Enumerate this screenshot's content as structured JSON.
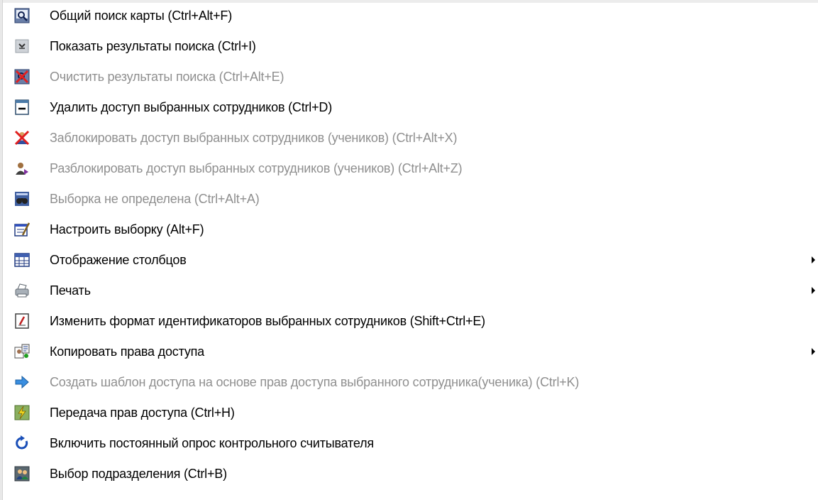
{
  "menu": {
    "items": [
      {
        "label": "Общий поиск карты (Ctrl+Alt+F)",
        "enabled": true,
        "submenu": false,
        "icon": "map-search-icon"
      },
      {
        "label": "Показать результаты поиска (Ctrl+I)",
        "enabled": true,
        "submenu": false,
        "icon": "show-results-icon"
      },
      {
        "label": "Очистить результаты поиска (Ctrl+Alt+E)",
        "enabled": false,
        "submenu": false,
        "icon": "clear-results-icon"
      },
      {
        "label": "Удалить доступ выбранных сотрудников (Ctrl+D)",
        "enabled": true,
        "submenu": false,
        "icon": "delete-access-icon"
      },
      {
        "label": "Заблокировать доступ выбранных сотрудников (учеников) (Ctrl+Alt+X)",
        "enabled": false,
        "submenu": false,
        "icon": "block-access-icon"
      },
      {
        "label": "Разблокировать доступ выбранных сотрудников (учеников) (Ctrl+Alt+Z)",
        "enabled": false,
        "submenu": false,
        "icon": "unblock-access-icon"
      },
      {
        "label": "Выборка не определена (Ctrl+Alt+A)",
        "enabled": false,
        "submenu": false,
        "icon": "binoculars-icon"
      },
      {
        "label": "Настроить выборку (Alt+F)",
        "enabled": true,
        "submenu": false,
        "icon": "configure-selection-icon"
      },
      {
        "label": "Отображение столбцов",
        "enabled": true,
        "submenu": true,
        "icon": "columns-icon"
      },
      {
        "label": "Печать",
        "enabled": true,
        "submenu": true,
        "icon": "printer-icon"
      },
      {
        "label": "Изменить формат идентификаторов выбранных сотрудников (Shift+Ctrl+E)",
        "enabled": true,
        "submenu": false,
        "icon": "id-format-icon"
      },
      {
        "label": "Копировать права доступа",
        "enabled": true,
        "submenu": true,
        "icon": "copy-rights-icon"
      },
      {
        "label": "Создать шаблон доступа на основе прав доступа выбранного сотрудника(ученика) (Ctrl+K)",
        "enabled": false,
        "submenu": false,
        "icon": "blue-arrow-icon"
      },
      {
        "label": "Передача прав доступа (Ctrl+H)",
        "enabled": true,
        "submenu": false,
        "icon": "lightning-icon"
      },
      {
        "label": "Включить постоянный опрос контрольного считывателя",
        "enabled": true,
        "submenu": false,
        "icon": "refresh-icon"
      },
      {
        "label": "Выбор подразделения (Ctrl+B)",
        "enabled": true,
        "submenu": false,
        "icon": "department-icon"
      }
    ]
  }
}
